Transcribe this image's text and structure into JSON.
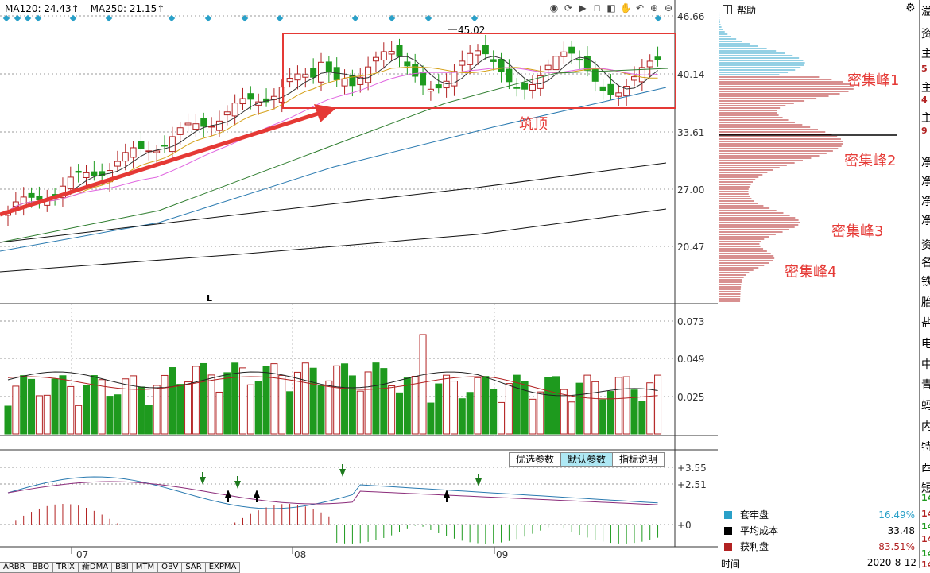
{
  "main": {
    "ma_legend": [
      "MA120: 24.43↑",
      "MA250: 21.15↑"
    ],
    "toolbar_icons": [
      "eye-icon",
      "refresh-icon",
      "play-icon",
      "lock-icon",
      "prev-icon",
      "hand-icon",
      "undo-icon",
      "zoom-in-icon",
      "zoom-out-icon"
    ],
    "price_labels": [
      "46.66",
      "40.14",
      "33.61",
      "27.00",
      "20.47"
    ],
    "vol_labels": [
      "0.073",
      "0.049",
      "0.025"
    ],
    "macd_labels": [
      "+3.55",
      "+2.51",
      "+0"
    ],
    "high_label": "45.02",
    "low_marker": "L",
    "month_labels": [
      "07",
      "08",
      "09"
    ],
    "param_tabs": [
      "优选参数",
      "默认参数",
      "指标说明"
    ],
    "active_param": 1,
    "bottom_tabs": [
      "ARBR",
      "BBO",
      "TRIX",
      "新DMA",
      "BBI",
      "MTM",
      "OBV",
      "SAR",
      "EXPMA"
    ],
    "annotations": {
      "top": "筑顶",
      "peak1": "密集峰1",
      "peak2": "密集峰2",
      "peak3": "密集峰3",
      "peak4": "密集峰4"
    },
    "colors": {
      "up": "#b22222",
      "down": "#1e9a1e",
      "annot": "#e53935",
      "peak_blue": "#2aa0c8",
      "peak_red": "#b22222"
    }
  },
  "panel": {
    "title": "帮助",
    "legend": [
      {
        "label": "套牢盘",
        "value": "16.49%",
        "color": "#2aa0c8"
      },
      {
        "label": "平均成本",
        "value": "33.48",
        "color": "#000000"
      },
      {
        "label": "获利盘",
        "value": "83.51%",
        "color": "#b22222"
      }
    ],
    "time_label": "时间",
    "date": "2020-8-12"
  },
  "edge_column": [
    "溢",
    "资",
    "主",
    "5",
    "主",
    "4",
    "主",
    "9",
    "净",
    "净",
    "净",
    "净",
    "资",
    "名",
    "铁",
    "胎",
    "盐",
    "电",
    "中",
    "青",
    "蚂",
    "内",
    "特",
    "西",
    "短",
    "14",
    "14",
    "14",
    "14",
    "14",
    "14"
  ]
}
